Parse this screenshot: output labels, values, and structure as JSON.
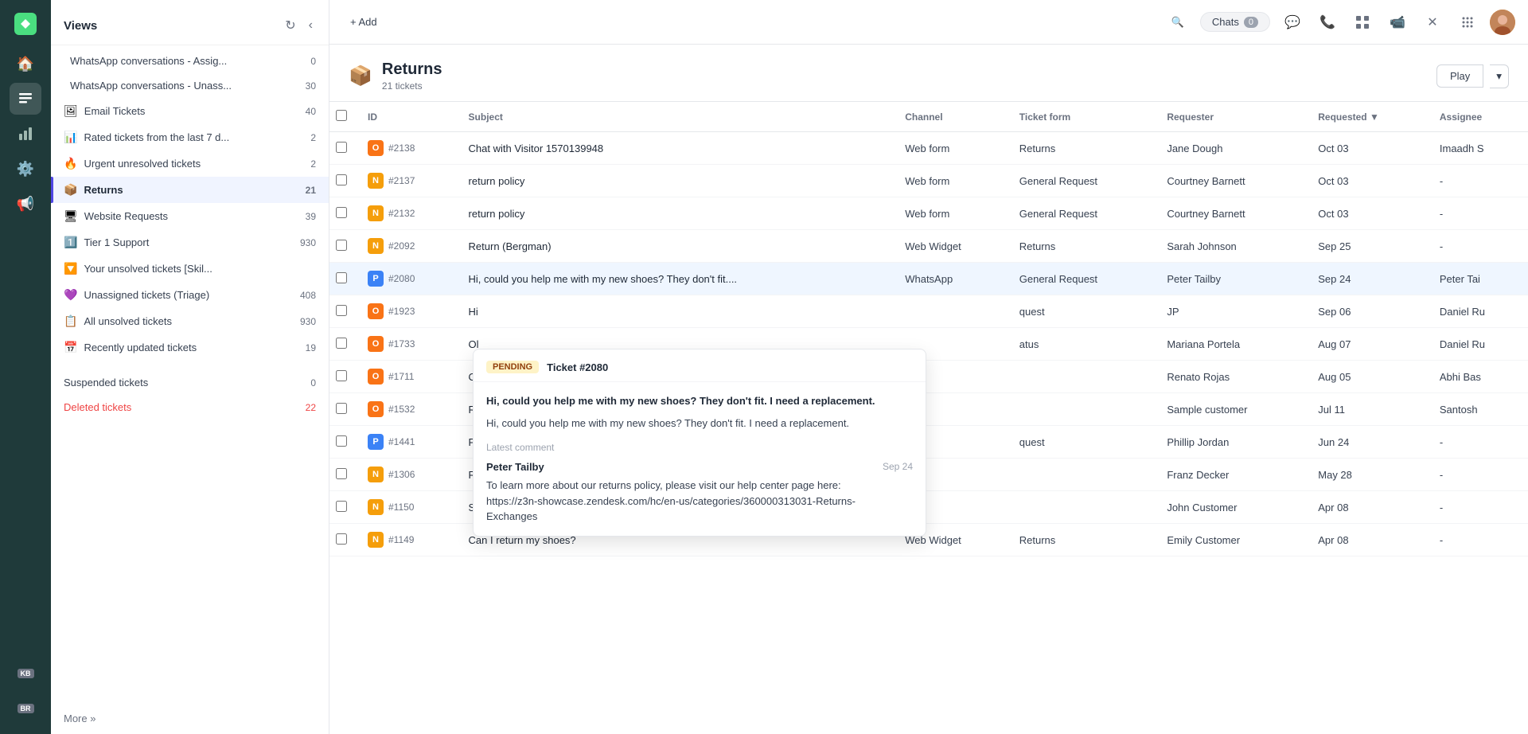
{
  "app": {
    "add_label": "+ Add"
  },
  "top_nav": {
    "chats_label": "Chats",
    "chats_count": "0",
    "play_label": "Play"
  },
  "views_sidebar": {
    "title": "Views",
    "items": [
      {
        "id": "whatsapp-assigned",
        "icon": "",
        "label": "WhatsApp conversations - Assig...",
        "count": "0",
        "color": "normal",
        "emoji": ""
      },
      {
        "id": "whatsapp-unassigned",
        "icon": "",
        "label": "WhatsApp conversations - Unass...",
        "count": "30",
        "color": "normal",
        "emoji": ""
      },
      {
        "id": "email-tickets",
        "icon": "🖼",
        "label": "Email Tickets",
        "count": "40",
        "color": "normal",
        "emoji": ""
      },
      {
        "id": "rated-tickets",
        "icon": "📊",
        "label": "Rated tickets from the last 7 d...",
        "count": "2",
        "color": "normal",
        "emoji": ""
      },
      {
        "id": "urgent-unresolved",
        "icon": "🔥",
        "label": "Urgent unresolved tickets",
        "count": "2",
        "color": "normal",
        "emoji": ""
      },
      {
        "id": "returns",
        "icon": "📦",
        "label": "Returns",
        "count": "21",
        "color": "normal",
        "active": true,
        "emoji": ""
      },
      {
        "id": "website-requests",
        "icon": "🖥",
        "label": "Website Requests",
        "count": "39",
        "color": "normal",
        "emoji": ""
      },
      {
        "id": "tier1-support",
        "icon": "1️⃣",
        "label": "Tier 1 Support",
        "count": "930",
        "color": "normal",
        "emoji": ""
      },
      {
        "id": "your-unsolved",
        "icon": "🔽",
        "label": "Your unsolved tickets [Skil...",
        "count": "",
        "color": "normal",
        "emoji": ""
      },
      {
        "id": "unassigned-triage",
        "icon": "💜",
        "label": "Unassigned tickets (Triage)",
        "count": "408",
        "color": "normal",
        "emoji": ""
      },
      {
        "id": "all-unsolved",
        "icon": "📋",
        "label": "All unsolved tickets",
        "count": "930",
        "color": "normal",
        "emoji": ""
      },
      {
        "id": "recently-updated",
        "icon": "📅",
        "label": "Recently updated tickets",
        "count": "19",
        "color": "normal",
        "emoji": ""
      }
    ],
    "suspended_label": "Suspended tickets",
    "suspended_count": "0",
    "deleted_label": "Deleted tickets",
    "deleted_count": "22",
    "more_label": "More »"
  },
  "ticket_view": {
    "icon": "📦",
    "title": "Returns",
    "subtitle": "21 tickets",
    "columns": [
      {
        "id": "id",
        "label": "ID"
      },
      {
        "id": "subject",
        "label": "Subject"
      },
      {
        "id": "channel",
        "label": "Channel"
      },
      {
        "id": "ticket_form",
        "label": "Ticket form"
      },
      {
        "id": "requester",
        "label": "Requester"
      },
      {
        "id": "requested",
        "label": "Requested",
        "sortable": true
      },
      {
        "id": "assignee",
        "label": "Assignee"
      }
    ],
    "tickets": [
      {
        "id": "#2138",
        "badge": "O",
        "badge_color": "orange",
        "subject": "Chat with Visitor 1570139948",
        "channel": "Web form",
        "ticket_form": "Returns",
        "requester": "Jane Dough",
        "requested": "Oct 03",
        "assignee": "Imaadh S"
      },
      {
        "id": "#2137",
        "badge": "N",
        "badge_color": "yellow",
        "subject": "return policy",
        "channel": "Web form",
        "ticket_form": "General Request",
        "requester": "Courtney Barnett",
        "requested": "Oct 03",
        "assignee": "-"
      },
      {
        "id": "#2132",
        "badge": "N",
        "badge_color": "yellow",
        "subject": "return policy",
        "channel": "Web form",
        "ticket_form": "General Request",
        "requester": "Courtney Barnett",
        "requested": "Oct 03",
        "assignee": "-"
      },
      {
        "id": "#2092",
        "badge": "N",
        "badge_color": "yellow",
        "subject": "Return (Bergman)",
        "channel": "Web Widget",
        "ticket_form": "Returns",
        "requester": "Sarah Johnson",
        "requested": "Sep 25",
        "assignee": "-"
      },
      {
        "id": "#2080",
        "badge": "P",
        "badge_color": "blue",
        "subject": "Hi, could you help me with my new shoes? They don't fit....",
        "channel": "WhatsApp",
        "ticket_form": "General Request",
        "requester": "Peter Tailby",
        "requested": "Sep 24",
        "assignee": "Peter Tai",
        "highlighted": true
      },
      {
        "id": "#1923",
        "badge": "O",
        "badge_color": "orange",
        "subject": "Hi",
        "channel": "",
        "ticket_form": "quest",
        "requester": "JP",
        "requested": "Sep 06",
        "assignee": "Daniel Ru"
      },
      {
        "id": "#1733",
        "badge": "O",
        "badge_color": "orange",
        "subject": "Ol",
        "channel": "",
        "ticket_form": "atus",
        "requester": "Mariana Portela",
        "requested": "Aug 07",
        "assignee": "Daniel Ru"
      },
      {
        "id": "#1711",
        "badge": "O",
        "badge_color": "orange",
        "subject": "Ol",
        "channel": "",
        "ticket_form": "",
        "requester": "Renato Rojas",
        "requested": "Aug 05",
        "assignee": "Abhi Bas"
      },
      {
        "id": "#1532",
        "badge": "O",
        "badge_color": "orange",
        "subject": "Re",
        "channel": "",
        "ticket_form": "",
        "requester": "Sample customer",
        "requested": "Jul 11",
        "assignee": "Santosh"
      },
      {
        "id": "#1441",
        "badge": "P",
        "badge_color": "blue",
        "subject": "Fa",
        "channel": "",
        "ticket_form": "quest",
        "requester": "Phillip Jordan",
        "requested": "Jun 24",
        "assignee": "-"
      },
      {
        "id": "#1306",
        "badge": "N",
        "badge_color": "yellow",
        "subject": "Re",
        "channel": "",
        "ticket_form": "",
        "requester": "Franz Decker",
        "requested": "May 28",
        "assignee": "-"
      },
      {
        "id": "#1150",
        "badge": "N",
        "badge_color": "yellow",
        "subject": "Sh",
        "channel": "",
        "ticket_form": "",
        "requester": "John Customer",
        "requested": "Apr 08",
        "assignee": "-"
      },
      {
        "id": "#1149",
        "badge": "N",
        "badge_color": "yellow",
        "subject": "Can I return my shoes?",
        "channel": "Web Widget",
        "ticket_form": "Returns",
        "requester": "Emily Customer",
        "requested": "Apr 08",
        "assignee": "-"
      }
    ]
  },
  "popup": {
    "status": "PENDING",
    "ticket_id": "Ticket #2080",
    "bold_text": "Hi, could you help me with my new shoes? They don't fit. I need a replacement.",
    "normal_text": "Hi, could you help me with my new shoes? They don't fit. I need a replacement.",
    "latest_comment_label": "Latest comment",
    "commenter": "Peter Tailby",
    "comment_date": "Sep 24",
    "comment_text": "To learn more about our returns policy, please visit our help center page here: https://z3n-showcase.zendesk.com/hc/en-us/categories/360000313031-Returns-Exchanges"
  }
}
